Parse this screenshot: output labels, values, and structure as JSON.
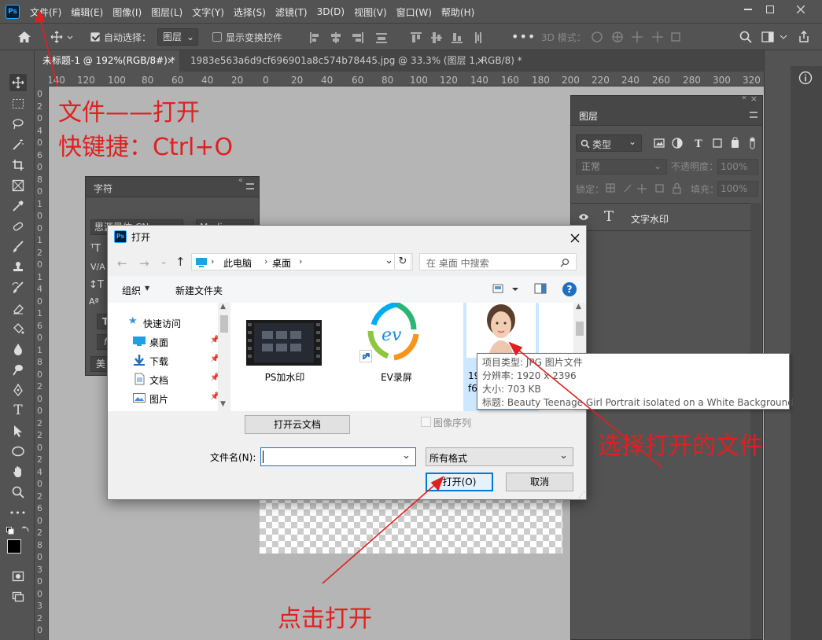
{
  "menu": {
    "logo": "Ps",
    "items": [
      "文件(F)",
      "编辑(E)",
      "图像(I)",
      "图层(L)",
      "文字(Y)",
      "选择(S)",
      "滤镜(T)",
      "3D(D)",
      "视图(V)",
      "窗口(W)",
      "帮助(H)"
    ]
  },
  "options": {
    "auto_select_label": "自动选择：",
    "auto_select_value": "图层",
    "show_transform_label": "显示变换控件",
    "mode_3d_label": "3D 模式："
  },
  "tabs": [
    {
      "label": "未标题-1 @ 192%(RGB/8#) *"
    },
    {
      "label": "1983e563a6d9cf696901a8c574b78445.jpg @ 33.3% (图层 1, RGB/8) *"
    }
  ],
  "ruler": {
    "h_labels": [
      "140",
      "120",
      "100",
      "80",
      "60",
      "40",
      "20",
      "0",
      "20",
      "40",
      "60",
      "80",
      "100",
      "120",
      "140",
      "160",
      "180",
      "200",
      "220",
      "240",
      "260",
      "280",
      "300",
      "320"
    ],
    "v_labels": [
      "0",
      "2",
      "0",
      "4",
      "0",
      "6",
      "0",
      "8",
      "0",
      "1",
      "0",
      "0",
      "1",
      "2",
      "0",
      "1",
      "4",
      "0",
      "1",
      "6",
      "0",
      "1",
      "8",
      "0",
      "2",
      "0",
      "0",
      "2",
      "2",
      "0",
      "2",
      "4",
      "0",
      "2",
      "6",
      "0",
      "2",
      "8",
      "0",
      "3",
      "0",
      "0",
      "3",
      "2",
      "0"
    ]
  },
  "char_panel": {
    "title": "字符",
    "font_family": "思源黑体 CN",
    "font_style": "Medium",
    "bottom_label": "美"
  },
  "layers_panel": {
    "title": "图层",
    "filter_label": "类型",
    "blend_mode": "正常",
    "opacity_label": "不透明度：",
    "opacity_value": "100%",
    "lock_label": "锁定：",
    "fill_label": "填充：",
    "fill_value": "100%",
    "layers": [
      {
        "name": "文字水印",
        "type_icon": "T"
      }
    ]
  },
  "dialog": {
    "title": "打开",
    "breadcrumb": [
      "此电脑",
      "桌面"
    ],
    "search_placeholder": "在 桌面 中搜索",
    "organize": "组织",
    "new_folder": "新建文件夹",
    "nav": [
      {
        "label": "快速访问",
        "icon": "star-icon"
      },
      {
        "label": "桌面",
        "icon": "desktop-icon"
      },
      {
        "label": "下载",
        "icon": "download-icon"
      },
      {
        "label": "文档",
        "icon": "document-icon"
      },
      {
        "label": "图片",
        "icon": "picture-icon"
      }
    ],
    "files": [
      {
        "name": "PS加水印"
      },
      {
        "name": "EV录屏"
      },
      {
        "name": "19",
        "name_line2": "f6"
      }
    ],
    "open_cloud": "打开云文档",
    "image_sequence": "图像序列",
    "filename_label": "文件名(N):",
    "filename_value": "",
    "filetype": "所有格式",
    "open_btn": "打开(O)",
    "cancel_btn": "取消"
  },
  "tooltip": {
    "type": "项目类型: JPG 图片文件",
    "resolution": "分辨率: 1920 x 2396",
    "size": "大小: 703 KB",
    "title": "标题: Beauty Teenage Girl Portrait isolated on a White Background"
  },
  "annotations": {
    "a1": "文件——打开",
    "a2": "快键捷：Ctrl+O",
    "a3": "选择打开的文件",
    "a4": "点击打开"
  },
  "colors": {
    "ui_bg": "#535353",
    "canvas_bg": "#b5b5b5",
    "annotation": "#e02020",
    "accent": "#0078d7"
  }
}
